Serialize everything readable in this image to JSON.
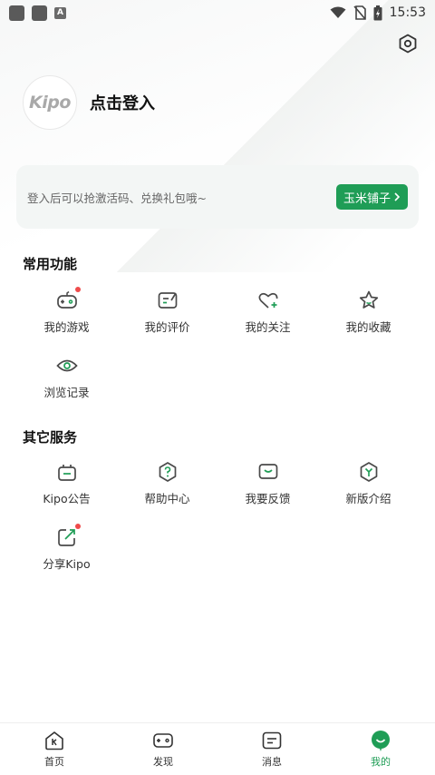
{
  "status_bar": {
    "time": "15:53",
    "left_icons": [
      "notification-square-icon",
      "notification-square-icon",
      "a-icon"
    ],
    "right_icons": [
      "wifi-icon",
      "no-sim-icon",
      "battery-charging-icon"
    ]
  },
  "header": {
    "settings_icon": "hexagon-settings-icon",
    "avatar_text": "Kipo",
    "login_text": "点击登入"
  },
  "banner": {
    "text": "登入后可以抢激活码、兑换礼包哦~",
    "button_label": "玉米铺子",
    "button_icon": "chevron-right-icon"
  },
  "common_functions": {
    "title": "常用功能",
    "items": [
      {
        "label": "我的游戏",
        "icon": "gamepad-icon",
        "badge": true
      },
      {
        "label": "我的评价",
        "icon": "review-icon",
        "badge": false
      },
      {
        "label": "我的关注",
        "icon": "heart-plus-icon",
        "badge": false
      },
      {
        "label": "我的收藏",
        "icon": "star-icon",
        "badge": false
      },
      {
        "label": "浏览记录",
        "icon": "eye-icon",
        "badge": false
      }
    ]
  },
  "other_services": {
    "title": "其它服务",
    "items": [
      {
        "label": "Kipo公告",
        "icon": "announcement-icon",
        "badge": false
      },
      {
        "label": "帮助中心",
        "icon": "help-icon",
        "badge": false
      },
      {
        "label": "我要反馈",
        "icon": "feedback-icon",
        "badge": false
      },
      {
        "label": "新版介绍",
        "icon": "new-version-icon",
        "badge": false
      },
      {
        "label": "分享Kipo",
        "icon": "share-icon",
        "badge": true
      }
    ]
  },
  "bottom_nav": {
    "items": [
      {
        "label": "首页",
        "icon": "home-icon",
        "active": false
      },
      {
        "label": "发现",
        "icon": "discover-gamepad-icon",
        "active": false
      },
      {
        "label": "消息",
        "icon": "message-icon",
        "active": false
      },
      {
        "label": "我的",
        "icon": "me-face-icon",
        "active": true
      }
    ]
  },
  "colors": {
    "accent": "#1f9d56",
    "badge": "#ef4b4b",
    "icon": "#4a4a4a"
  }
}
